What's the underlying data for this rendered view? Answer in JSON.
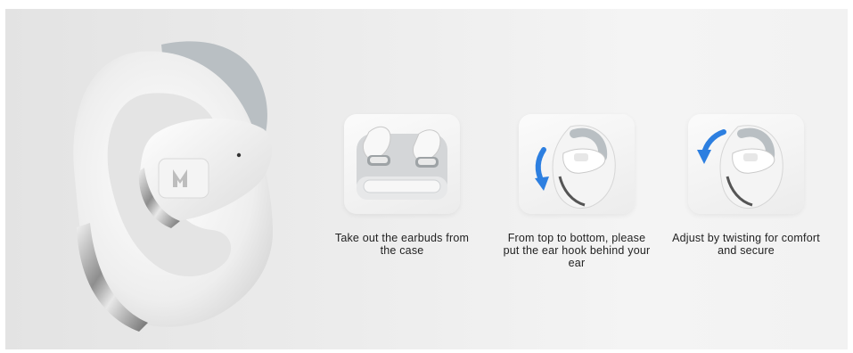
{
  "steps": [
    {
      "caption": "Take out the earbuds from the case",
      "icon": "earbuds-in-case-image"
    },
    {
      "caption": "From top to bottom, please put the ear hook behind your ear",
      "icon": "ear-hook-down-arrow-image"
    },
    {
      "caption": "Adjust by twisting for comfort and secure",
      "icon": "twist-adjust-arrow-image"
    }
  ],
  "colors": {
    "background": "#ececec",
    "earbud_white": "#f7f7f7",
    "hook_gray": "#b9bfc3",
    "arrow_blue": "#2d7fe0",
    "caption_text": "#222222"
  }
}
